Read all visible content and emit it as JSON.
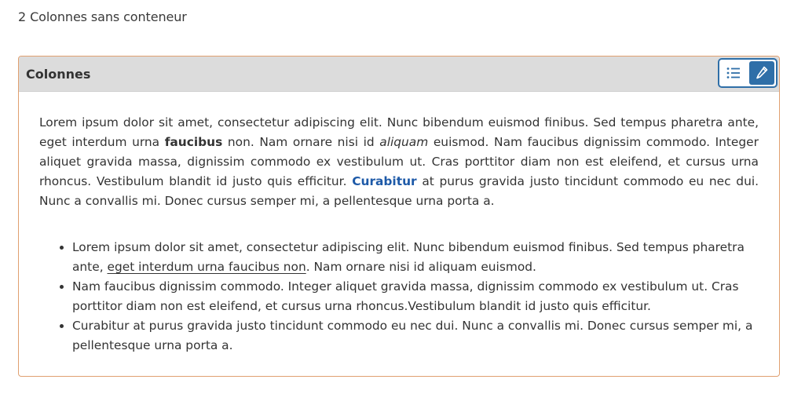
{
  "page": {
    "heading": "2 Colonnes sans conteneur"
  },
  "panel": {
    "title": "Colonnes",
    "actions": {
      "list_icon": "list-icon",
      "edit_icon": "pencil-icon",
      "accent": "#2f6fa8"
    },
    "paragraph": {
      "part1": "Lorem ipsum dolor sit amet, consectetur adipiscing elit. Nunc bibendum euismod finibus. Sed tempus pharetra ante, eget interdum urna ",
      "bold1": "faucibus",
      "part2": " non. Nam ornare nisi id ",
      "italic1": "aliquam",
      "part3": " euismod. Nam faucibus dignissim commodo. Integer aliquet gravida massa, dignissim commodo ex vestibulum ut. Cras porttitor diam non est eleifend, et cursus urna rhoncus. Vestibulum blandit id justo quis efficitur. ",
      "bold_link": "Curabitur",
      "part4": " at purus gravida justo tincidunt commodo eu nec dui. Nunc a convallis mi. Donec cursus semper mi, a pellentesque urna porta a."
    },
    "list": {
      "items": [
        {
          "before": "Lorem ipsum dolor sit amet, consectetur adipiscing elit. Nunc bibendum euismod finibus. Sed tempus pharetra ante, ",
          "underlined": "eget interdum urna faucibus non",
          "after": ". Nam ornare nisi id aliquam euismod."
        },
        {
          "text": "Nam faucibus dignissim commodo. Integer aliquet gravida massa, dignissim commodo ex vestibulum ut. Cras porttitor diam non est eleifend, et cursus urna rhoncus.Vestibulum blandit id justo quis efficitur."
        },
        {
          "text": "Curabitur at purus gravida justo tincidunt commodo eu nec dui. Nunc a convallis mi. Donec cursus semper mi, a pellentesque urna porta a."
        }
      ]
    }
  }
}
